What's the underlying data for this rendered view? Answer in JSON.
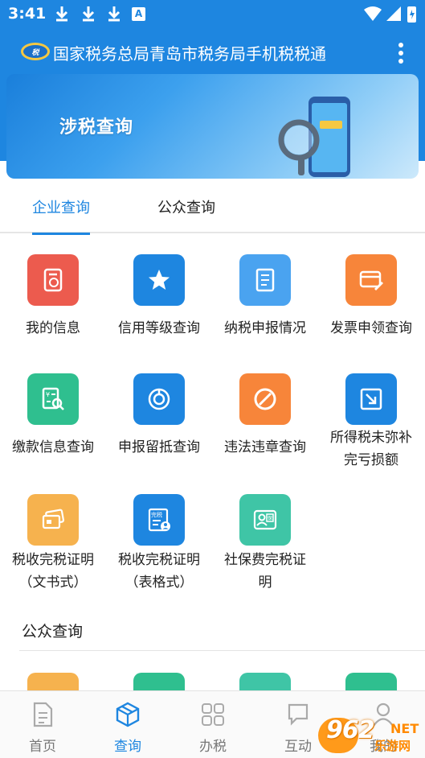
{
  "status_bar": {
    "time": "3:41",
    "a_badge": "A"
  },
  "app_bar": {
    "title": "国家税务总局青岛市税务局手机税税通"
  },
  "banner": {
    "title": "涉税查询"
  },
  "tabs": [
    {
      "label": "企业查询",
      "active": true
    },
    {
      "label": "公众查询",
      "active": false
    }
  ],
  "enterprise_items": [
    {
      "label": "我的信息",
      "icon": "profile-doc-icon",
      "color": "#ec5b4e"
    },
    {
      "label": "信用等级查询",
      "icon": "star-icon",
      "color": "#1e86e0"
    },
    {
      "label": "纳税申报情况",
      "icon": "document-icon",
      "color": "#4aa3f0"
    },
    {
      "label": "发票申领查询",
      "icon": "invoice-edit-icon",
      "color": "#f7853a"
    },
    {
      "label": "缴款信息查询",
      "icon": "yuan-search-icon",
      "color": "#2fbf8f"
    },
    {
      "label": "申报留抵查询",
      "icon": "pie-chart-icon",
      "color": "#1e86e0"
    },
    {
      "label": "违法违章查询",
      "icon": "prohibited-icon",
      "color": "#f7853a"
    },
    {
      "label": "所得税未弥补完亏损额",
      "label_lines": [
        "所得税未弥补",
        "完亏损额"
      ],
      "icon": "arrow-down-right-icon",
      "color": "#1e86e0"
    },
    {
      "label": "税收完税证明（文书式）",
      "label_lines": [
        "税收完税证明",
        "（文书式）"
      ],
      "icon": "card-icon",
      "color": "#f6b24e"
    },
    {
      "label": "税收完税证明（表格式）",
      "label_lines": [
        "税收完税证明",
        "（表格式）"
      ],
      "icon": "tax-form-icon",
      "color": "#1e86e0",
      "icon_text": "完税"
    },
    {
      "label": "社保费完税证明",
      "label_lines": [
        "社保费完税证",
        "明"
      ],
      "icon": "social-security-icon",
      "color": "#3fc5a6",
      "icon_text": "保"
    }
  ],
  "public_section": {
    "title": "公众查询"
  },
  "public_partial_colors": [
    "#f6b24e",
    "#2fbf8f",
    "#3fc5a6",
    "#2fbf8f"
  ],
  "bottom_nav": [
    {
      "label": "首页",
      "icon": "home-doc-icon",
      "active": false
    },
    {
      "label": "查询",
      "icon": "cube-icon",
      "active": true
    },
    {
      "label": "办税",
      "icon": "grid-icon",
      "active": false
    },
    {
      "label": "互动",
      "icon": "chat-icon",
      "active": false
    },
    {
      "label": "我的",
      "icon": "user-icon",
      "active": false
    }
  ],
  "watermark": {
    "text": "962",
    "domain": "NET",
    "sub": "乐游网"
  }
}
